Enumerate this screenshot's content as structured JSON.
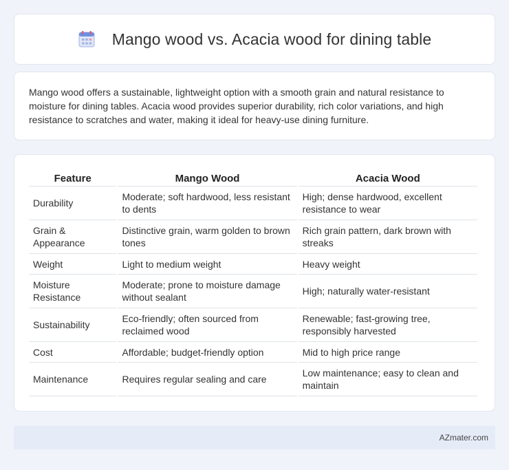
{
  "header": {
    "title": "Mango wood vs. Acacia wood for dining table",
    "icon": "calendar-icon"
  },
  "summary": {
    "text": "Mango wood offers a sustainable, lightweight option with a smooth grain and natural resistance to moisture for dining tables. Acacia wood provides superior durability, rich color variations, and high resistance to scratches and water, making it ideal for heavy-use dining furniture."
  },
  "table": {
    "headers": [
      "Feature",
      "Mango Wood",
      "Acacia Wood"
    ],
    "rows": [
      [
        "Durability",
        "Moderate; soft hardwood, less resistant to dents",
        "High; dense hardwood, excellent resistance to wear"
      ],
      [
        "Grain & Appearance",
        "Distinctive grain, warm golden to brown tones",
        "Rich grain pattern, dark brown with streaks"
      ],
      [
        "Weight",
        "Light to medium weight",
        "Heavy weight"
      ],
      [
        "Moisture Resistance",
        "Moderate; prone to moisture damage without sealant",
        "High; naturally water-resistant"
      ],
      [
        "Sustainability",
        "Eco-friendly; often sourced from reclaimed wood",
        "Renewable; fast-growing tree, responsibly harvested"
      ],
      [
        "Cost",
        "Affordable; budget-friendly option",
        "Mid to high price range"
      ],
      [
        "Maintenance",
        "Requires regular sealing and care",
        "Low maintenance; easy to clean and maintain"
      ]
    ]
  },
  "footer": {
    "text": "AZmater.com"
  }
}
